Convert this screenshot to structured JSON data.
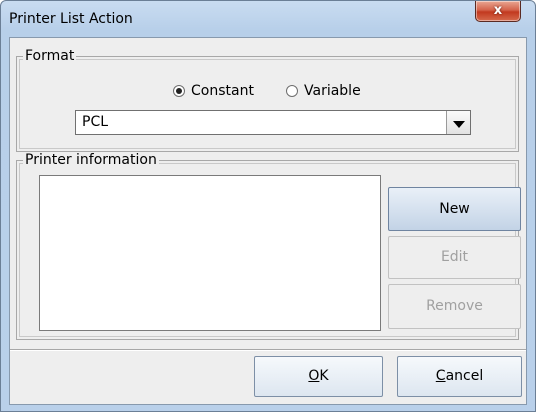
{
  "window": {
    "title": "Printer List Action",
    "close_glyph": "x"
  },
  "format_group": {
    "legend": "Format",
    "radio_constant_label": "Constant",
    "radio_variable_label": "Variable",
    "selected_radio": "Constant",
    "combo_value": "PCL"
  },
  "printer_group": {
    "legend": "Printer information",
    "list_items": []
  },
  "buttons": {
    "new_label": "New",
    "edit_label": "Edit",
    "remove_label": "Remove",
    "ok_label": "OK",
    "ok_mnemonic": "O",
    "ok_rest": "K",
    "cancel_mnemonic": "C",
    "cancel_rest": "ancel"
  },
  "icons": {
    "close": "close-icon",
    "dropdown": "chevron-down-icon"
  }
}
